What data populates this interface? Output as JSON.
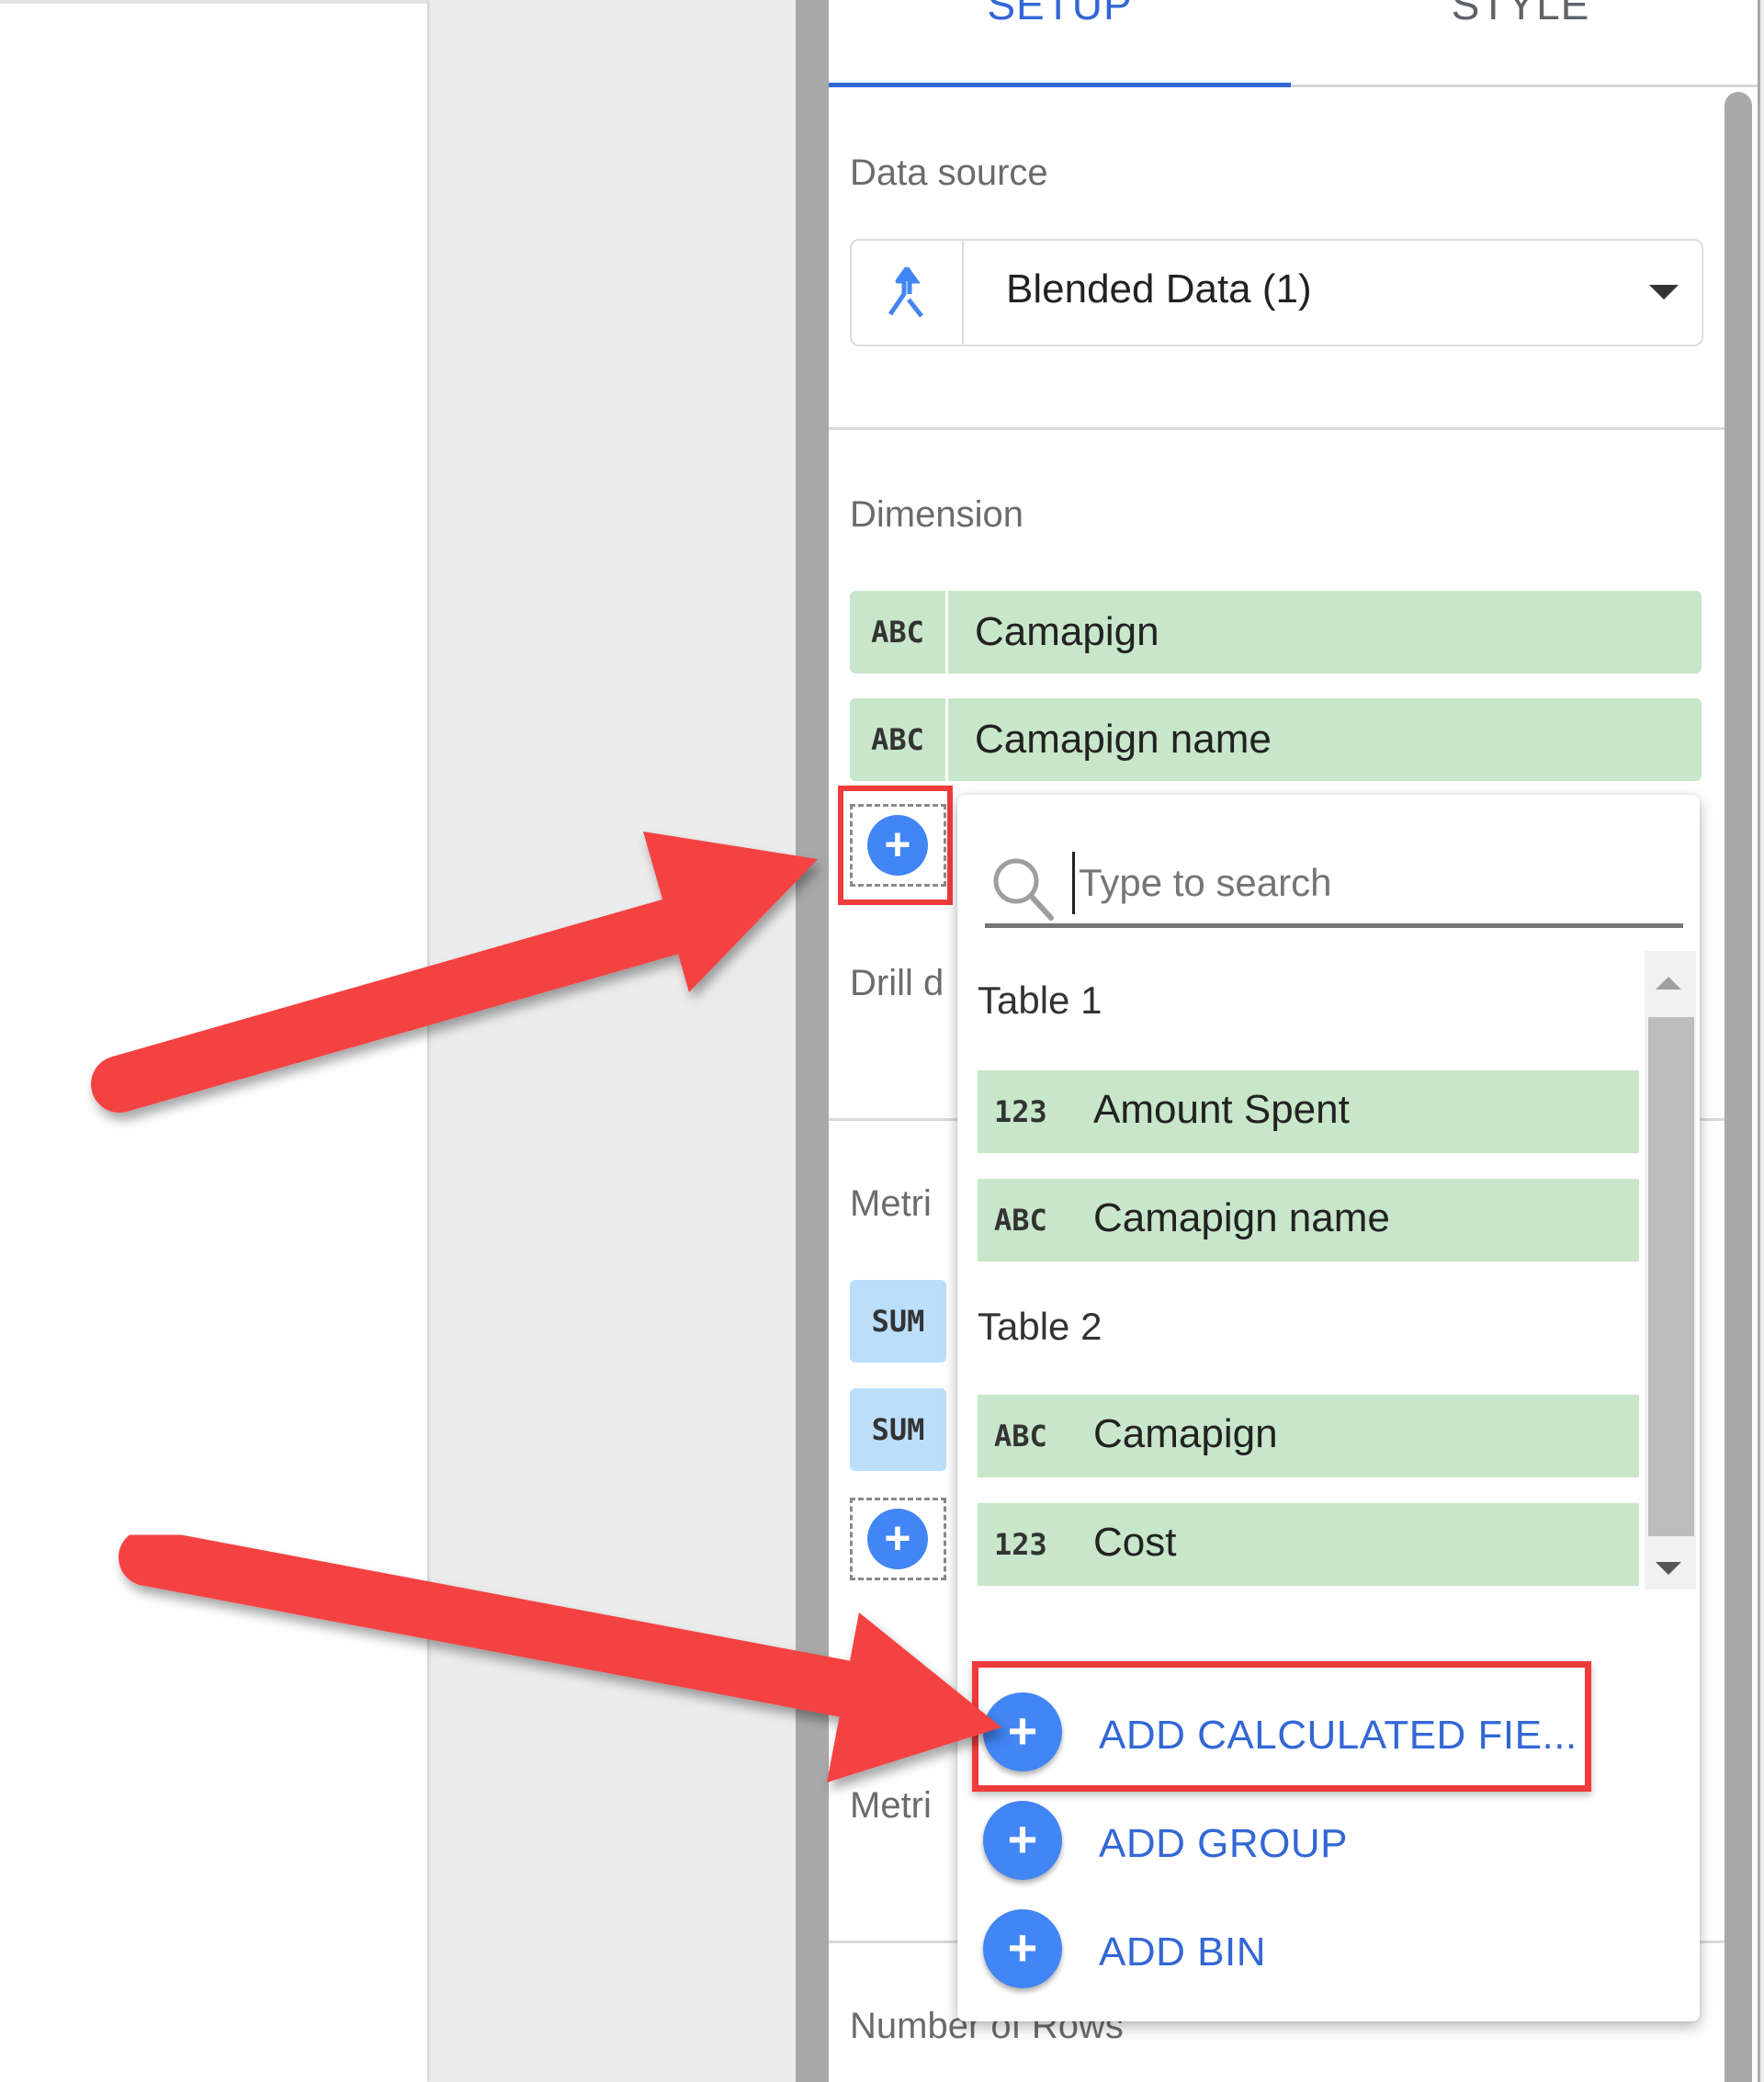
{
  "tabs": [
    {
      "label": "SETUP",
      "active": true
    },
    {
      "label": "STYLE",
      "active": false
    }
  ],
  "data_source": {
    "label": "Data source",
    "icon": "blend-icon",
    "value": "Blended Data (1)"
  },
  "dimension": {
    "label": "Dimension",
    "chips": [
      {
        "type": "ABC",
        "name": "Camapign"
      },
      {
        "type": "ABC",
        "name": "Camapign name"
      }
    ]
  },
  "drill_down": {
    "label": "Drill d"
  },
  "metric": {
    "label": "Metri",
    "chips": [
      {
        "agg": "SUM"
      },
      {
        "agg": "SUM"
      }
    ]
  },
  "metric_2": {
    "label": "Metri"
  },
  "number_of_rows": {
    "label": "Number of Rows"
  },
  "field_picker": {
    "search_placeholder": "Type to search",
    "groups": [
      {
        "label": "Table 1",
        "fields": [
          {
            "type": "123",
            "name": "Amount Spent"
          },
          {
            "type": "ABC",
            "name": "Camapign name"
          }
        ]
      },
      {
        "label": "Table 2",
        "fields": [
          {
            "type": "ABC",
            "name": "Camapign"
          },
          {
            "type": "123",
            "name": "Cost"
          }
        ]
      }
    ],
    "actions": [
      {
        "label": "ADD CALCULATED FIE...",
        "highlighted": true
      },
      {
        "label": "ADD GROUP",
        "highlighted": false
      },
      {
        "label": "ADD BIN",
        "highlighted": false
      }
    ]
  },
  "annotations": {
    "arrow_color": "#f44242",
    "highlight_color": "#ef3b3b"
  },
  "colors": {
    "accent": "#3367d6",
    "dimension_chip": "#c8e6c9",
    "metric_chip": "#bbdefb",
    "add_button": "#4285f4"
  }
}
